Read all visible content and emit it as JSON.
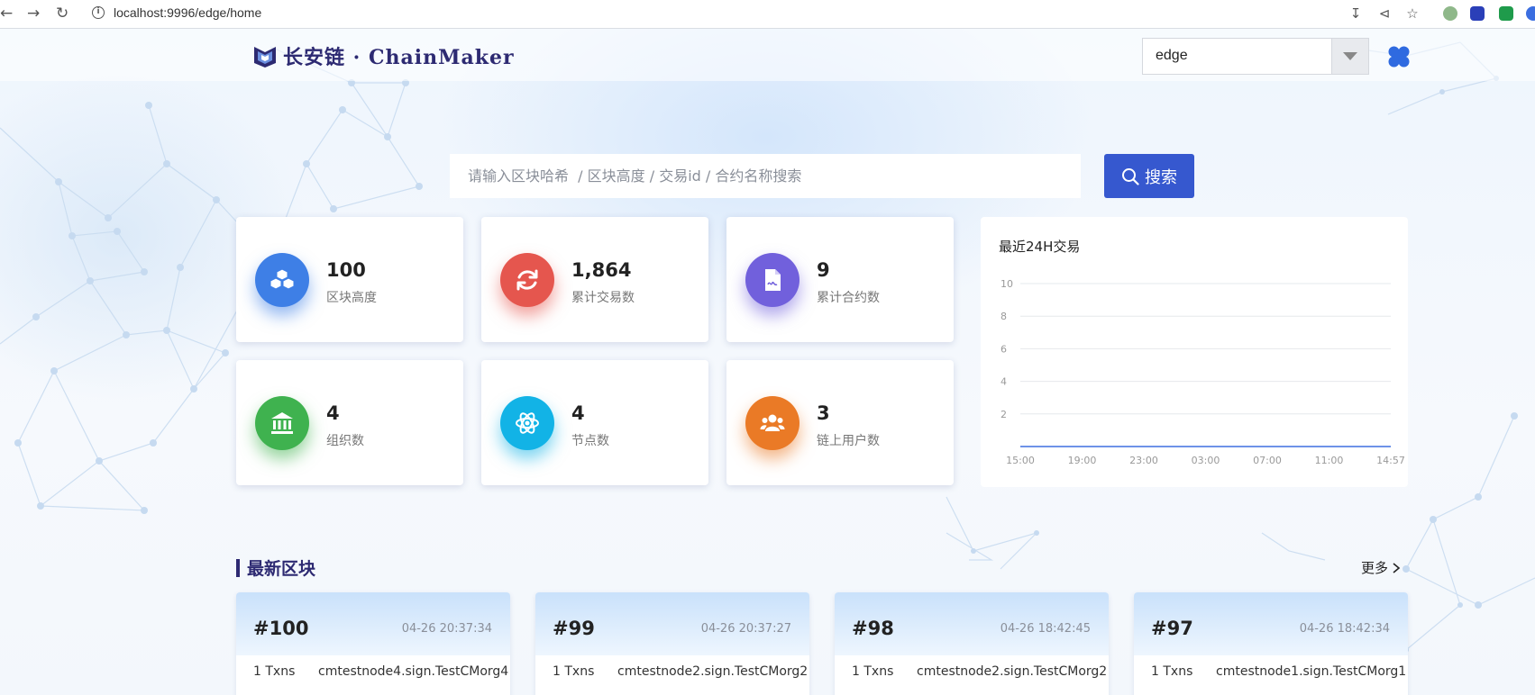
{
  "browser": {
    "url": "localhost:9996/edge/home"
  },
  "header": {
    "logo_text": "长安链 · ChainMaker",
    "chain_selected": "edge"
  },
  "search": {
    "placeholder": "请输入区块哈希  / 区块高度 / 交易id / 合约名称搜索",
    "button_label": "搜索"
  },
  "stats": [
    {
      "value": "100",
      "label": "区块高度",
      "icon": "cubes-icon",
      "color": "#3e7fe6"
    },
    {
      "value": "1,864",
      "label": "累计交易数",
      "icon": "refresh-icon",
      "color": "#e5564e"
    },
    {
      "value": "9",
      "label": "累计合约数",
      "icon": "contract-file-icon",
      "color": "#7160dc"
    },
    {
      "value": "4",
      "label": "组织数",
      "icon": "bank-icon",
      "color": "#3fb24f"
    },
    {
      "value": "4",
      "label": "节点数",
      "icon": "atom-icon",
      "color": "#12b3e6"
    },
    {
      "value": "3",
      "label": "链上用户数",
      "icon": "users-icon",
      "color": "#ea7a26"
    }
  ],
  "chart_data": {
    "type": "line",
    "title": "最近24H交易",
    "x": [
      "15:00",
      "19:00",
      "23:00",
      "03:00",
      "07:00",
      "11:00",
      "14:57"
    ],
    "series": [
      {
        "values": [
          0,
          0,
          0,
          0,
          0,
          0,
          0
        ],
        "color": "#3e6fe0"
      }
    ],
    "y_ticks": [
      2,
      4,
      6,
      8,
      10
    ],
    "ylim": [
      0,
      10
    ],
    "grid": true
  },
  "latest_blocks": {
    "title": "最新区块",
    "more_label": "更多",
    "items": [
      {
        "number": "#100",
        "time": "04-26 20:37:34",
        "txns": "1 Txns",
        "proposer": "cmtestnode4.sign.TestCMorg4"
      },
      {
        "number": "#99",
        "time": "04-26 20:37:27",
        "txns": "1 Txns",
        "proposer": "cmtestnode2.sign.TestCMorg2"
      },
      {
        "number": "#98",
        "time": "04-26 18:42:45",
        "txns": "1 Txns",
        "proposer": "cmtestnode2.sign.TestCMorg2"
      },
      {
        "number": "#97",
        "time": "04-26 18:42:34",
        "txns": "1 Txns",
        "proposer": "cmtestnode1.sign.TestCMorg1"
      }
    ]
  }
}
